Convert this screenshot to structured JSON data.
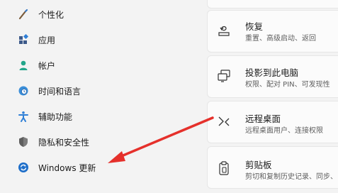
{
  "sidebar": {
    "items": [
      {
        "label": "个性化",
        "icon": "brush-icon"
      },
      {
        "label": "应用",
        "icon": "apps-icon"
      },
      {
        "label": "帐户",
        "icon": "account-icon"
      },
      {
        "label": "时间和语言",
        "icon": "globe-clock-icon"
      },
      {
        "label": "辅助功能",
        "icon": "accessibility-icon"
      },
      {
        "label": "隐私和安全性",
        "icon": "shield-icon"
      },
      {
        "label": "Windows 更新",
        "icon": "sync-icon"
      }
    ]
  },
  "cards": [
    {
      "title": "恢复",
      "subtitle": "重置、高级启动、返回",
      "icon": "recovery-icon"
    },
    {
      "title": "投影到此电脑",
      "subtitle": "权限、配对 PIN、可发现性",
      "icon": "project-icon"
    },
    {
      "title": "远程桌面",
      "subtitle": "远程桌面用户、连接权限",
      "icon": "remote-desktop-icon"
    },
    {
      "title": "剪贴板",
      "subtitle": "剪切和复制历史记录、同步、",
      "icon": "clipboard-icon"
    }
  ],
  "colors": {
    "annotation_arrow": "#e5302b",
    "accent": "#0067c0"
  }
}
